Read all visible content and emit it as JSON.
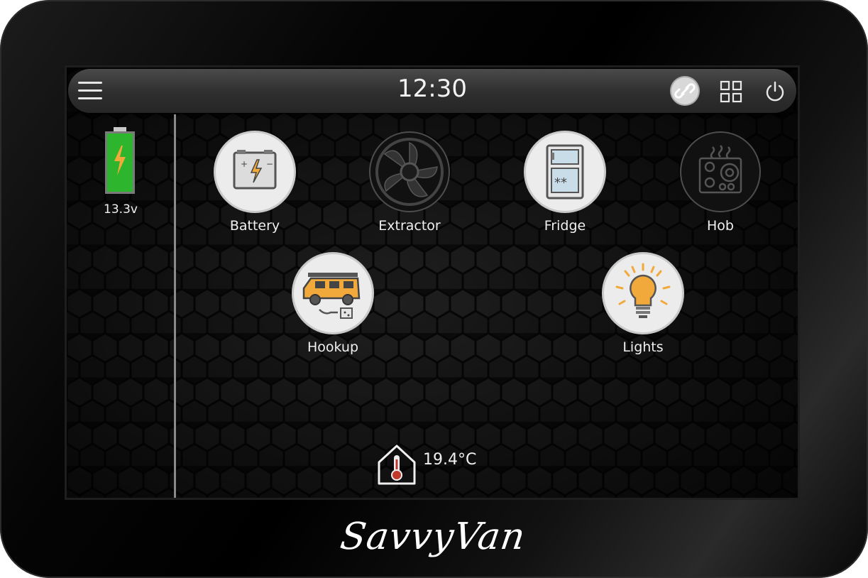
{
  "header": {
    "time": "12:30",
    "icons": {
      "menu": "menu-icon",
      "link": "link-icon",
      "apps": "apps-grid-icon",
      "power": "power-icon"
    }
  },
  "sidebar": {
    "battery_level": 1.0,
    "battery_voltage": "13.3v",
    "battery_color": "#2db52d"
  },
  "tiles": [
    {
      "label": "Battery",
      "icon": "car-battery-icon",
      "state": "on"
    },
    {
      "label": "Extractor",
      "icon": "fan-icon",
      "state": "off"
    },
    {
      "label": "Fridge",
      "icon": "fridge-icon",
      "state": "on"
    },
    {
      "label": "Hob",
      "icon": "hob-icon",
      "state": "off"
    },
    {
      "label": "Hookup",
      "icon": "van-hookup-icon",
      "state": "on"
    },
    {
      "label": "Lights",
      "icon": "light-bulb-icon",
      "state": "on"
    }
  ],
  "footer": {
    "temperature": "19.4°C",
    "brand": "SavvyVan"
  },
  "colors": {
    "accent_orange": "#f2a93b",
    "active_tile": "#ececec",
    "text": "#f0f0f0"
  }
}
